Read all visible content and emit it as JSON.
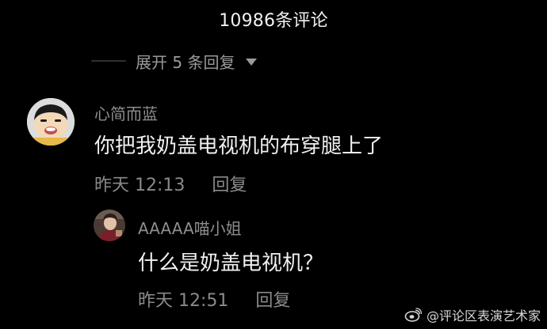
{
  "header": {
    "comment_count_title": "10986条评论"
  },
  "expand_replies": {
    "label": "展开 5 条回复",
    "icon": "caret-down-icon"
  },
  "comment": {
    "username": "心简而蓝",
    "text": "你把我奶盖电视机的布穿腿上了",
    "time": "昨天 12:13",
    "reply_label": "回复",
    "avatar_icon": "cartoon-avatar"
  },
  "reply": {
    "username": "AAAAA喵小姐",
    "text": "什么是奶盖电视机？",
    "time": "昨天 12:51",
    "reply_label": "回复",
    "avatar_icon": "photo-avatar"
  },
  "watermark": {
    "text": "@评论区表演艺术家",
    "icon": "weibo-icon"
  },
  "colors": {
    "background": "#000000",
    "primary_text": "#f0f0f0",
    "secondary_text": "#8e8e8e"
  }
}
